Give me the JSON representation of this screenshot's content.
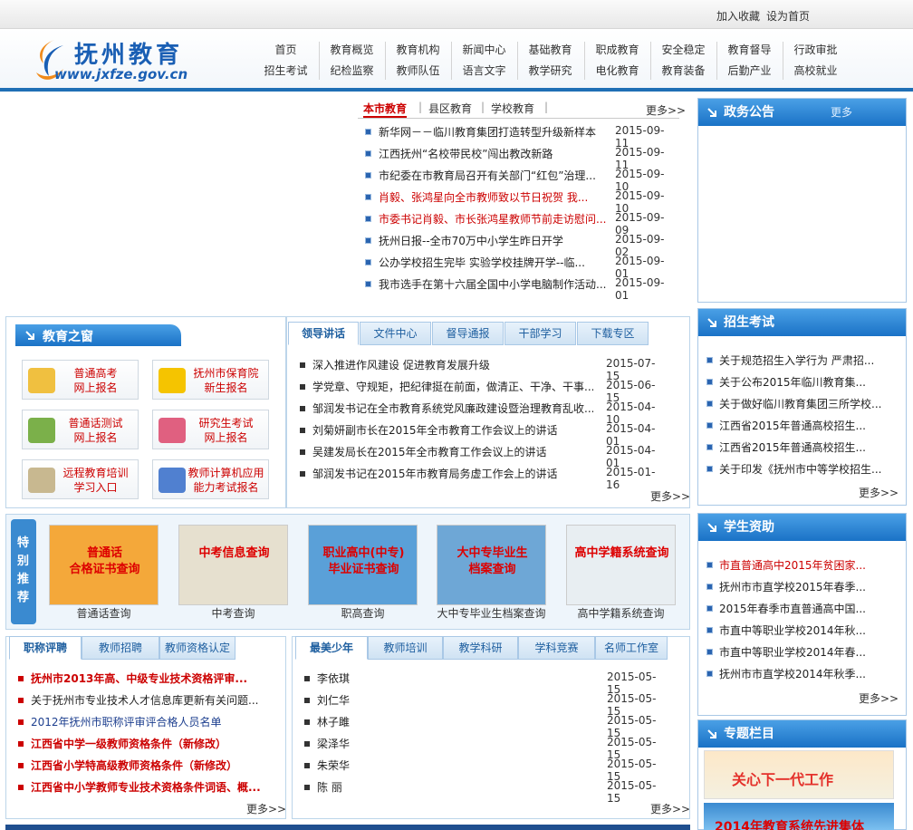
{
  "topbar": {
    "add_favorite": "加入收藏",
    "set_home": "设为首页"
  },
  "logo": {
    "title": "抚州教育",
    "url": "www.jxfze.gov.cn"
  },
  "nav": {
    "row1": [
      "首页",
      "教育概览",
      "教育机构",
      "新闻中心",
      "基础教育",
      "职成教育",
      "安全稳定",
      "教育督导",
      "行政审批"
    ],
    "row2": [
      "招生考试",
      "纪检监察",
      "教师队伍",
      "语言文字",
      "教学研究",
      "电化教育",
      "教育装备",
      "后勤产业",
      "高校就业"
    ]
  },
  "news": {
    "tabs": [
      "本市教育",
      "县区教育",
      "学校教育"
    ],
    "more": "更多>>",
    "items": [
      {
        "title": "新华网－－临川教育集团打造转型升级新样本",
        "date": "2015-09-11",
        "red": false
      },
      {
        "title": "江西抚州“名校带民校”闯出教改新路",
        "date": "2015-09-11",
        "red": false
      },
      {
        "title": "市纪委在市教育局召开有关部门“红包”治理...",
        "date": "2015-09-10",
        "red": false
      },
      {
        "title": "肖毅、张鸿星向全市教师致以节日祝贺 我...",
        "date": "2015-09-10",
        "red": true
      },
      {
        "title": "市委书记肖毅、市长张鸿星教师节前走访慰问...",
        "date": "2015-09-09",
        "red": true
      },
      {
        "title": "抚州日报--全市70万中小学生昨日开学",
        "date": "2015-09-02",
        "red": false
      },
      {
        "title": "公办学校招生完毕 实验学校挂牌开学--临...",
        "date": "2015-09-01",
        "red": false
      },
      {
        "title": "我市选手在第十六届全国中小学电脑制作活动...",
        "date": "2015-09-01",
        "red": false
      }
    ]
  },
  "notice": {
    "title": "政务公告",
    "more": "更多"
  },
  "window": {
    "title": "教育之窗",
    "services": [
      {
        "line1": "普通高考",
        "line2": "网上报名",
        "color": "#f0c040"
      },
      {
        "line1": "抚州市保育院",
        "line2": "新生报名",
        "color": "#f5c400"
      },
      {
        "line1": "普通话测试",
        "line2": "网上报名",
        "color": "#7bb04a"
      },
      {
        "line1": "研究生考试",
        "line2": "网上报名",
        "color": "#e06080"
      },
      {
        "line1": "远程教育培训",
        "line2": "学习入口",
        "color": "#c8b890"
      },
      {
        "line1": "教师计算机应用",
        "line2": "能力考试报名",
        "color": "#5080d0"
      }
    ]
  },
  "speech": {
    "tabs": [
      "领导讲话",
      "文件中心",
      "督导通报",
      "干部学习",
      "下载专区"
    ],
    "more": "更多>>",
    "items": [
      {
        "title": "深入推进作风建设 促进教育发展升级",
        "date": "2015-07-15"
      },
      {
        "title": "学党章、守规矩，把纪律挺在前面，做清正、干净、干事...",
        "date": "2015-06-15"
      },
      {
        "title": "邹润发书记在全市教育系统党风廉政建设暨治理教育乱收...",
        "date": "2015-04-10"
      },
      {
        "title": "刘菊妍副市长在2015年全市教育工作会议上的讲话",
        "date": "2015-04-01"
      },
      {
        "title": "吴建发局长在2015年全市教育工作会议上的讲话",
        "date": "2015-04-01"
      },
      {
        "title": "邹润发书记在2015年市教育局务虚工作会上的讲话",
        "date": "2015-01-16"
      }
    ]
  },
  "featured": {
    "label": "特别推荐",
    "items": [
      {
        "img_text": "普通话\n合格证书查询",
        "caption": "普通话查询",
        "bg": "#f4a83a"
      },
      {
        "img_text": "中考信息查询",
        "caption": "中考查询",
        "bg": "#e6e0cf"
      },
      {
        "img_text": "职业高中(中专)\n毕业证书查询",
        "caption": "职高查询",
        "bg": "#5aa0d8"
      },
      {
        "img_text": "大中专毕业生\n档案查询",
        "caption": "大中专毕业生档案查询",
        "bg": "#6ea7d6"
      },
      {
        "img_text": "高中学籍系统查询",
        "caption": "高中学籍系统查询",
        "bg": "#e8eef2"
      }
    ]
  },
  "titles": {
    "tabs": [
      "职称评聘",
      "教师招聘",
      "教师资格认定"
    ],
    "more": "更多>>",
    "items": [
      {
        "title": "抚州市2013年高、中级专业技术资格评审...",
        "red": true,
        "bold": true
      },
      {
        "title": "关于抚州市专业技术人才信息库更新有关问题...",
        "red": false,
        "bold": false
      },
      {
        "title": "2012年抚州市职称评审评合格人员名单",
        "red": false,
        "bold": false,
        "blue": true
      },
      {
        "title": "江西省中学一级教师资格条件（新修改）",
        "red": true,
        "bold": true
      },
      {
        "title": "江西省小学特高级教师资格条件（新修改）",
        "red": true,
        "bold": true
      },
      {
        "title": "江西省中小学教师专业技术资格条件词语、概...",
        "red": true,
        "bold": true
      }
    ]
  },
  "youth": {
    "tabs": [
      "最美少年",
      "教师培训",
      "教学科研",
      "学科竞赛",
      "名师工作室"
    ],
    "more": "更多>>",
    "items": [
      {
        "name": "李依琪",
        "date": "2015-05-15"
      },
      {
        "name": "刘仁华",
        "date": "2015-05-15"
      },
      {
        "name": "林子雎",
        "date": "2015-05-15"
      },
      {
        "name": "梁泽华",
        "date": "2015-05-15"
      },
      {
        "name": "朱荣华",
        "date": "2015-05-15"
      },
      {
        "name": "陈  丽",
        "date": "2015-05-15"
      }
    ]
  },
  "admission": {
    "title": "招生考试",
    "more": "更多>>",
    "items": [
      "关于规范招生入学行为 严肃招...",
      "关于公布2015年临川教育集...",
      "关于做好临川教育集团三所学校...",
      "江西省2015年普通高校招生...",
      "江西省2015年普通高校招生...",
      "关于印发《抚州市中等学校招生..."
    ]
  },
  "aid": {
    "title": "学生资助",
    "more": "更多>>",
    "items": [
      {
        "title": "市直普通高中2015年贫困家...",
        "red": true
      },
      {
        "title": "抚州市市直学校2015年春季...",
        "red": false
      },
      {
        "title": "2015年春季市直普通高中国...",
        "red": false
      },
      {
        "title": "市直中等职业学校2014年秋...",
        "red": false
      },
      {
        "title": "市直中等职业学校2014年春...",
        "red": false
      },
      {
        "title": "抚州市市直学校2014年秋季...",
        "red": false
      }
    ]
  },
  "special": {
    "title": "专题栏目",
    "banner1": "关心下一代工作",
    "banner2": "2014年教育系统先进集体"
  }
}
